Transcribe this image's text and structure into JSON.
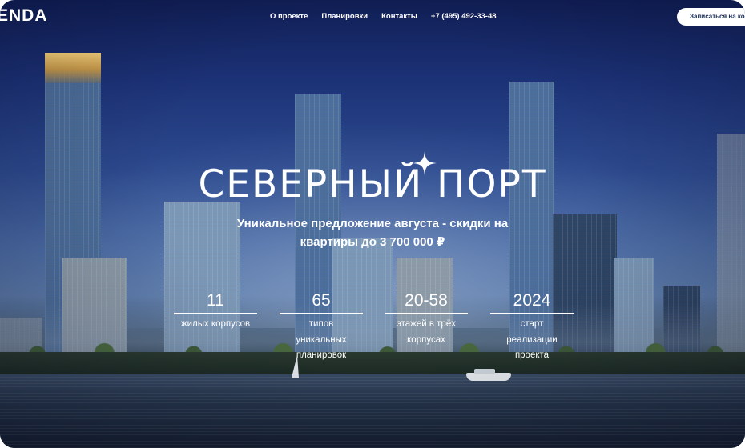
{
  "header": {
    "logo": "ENDA",
    "nav": [
      {
        "label": "О проекте"
      },
      {
        "label": "Планировки"
      },
      {
        "label": "Контакты"
      },
      {
        "label": "+7 (495) 492-33-48"
      }
    ],
    "cta_label": "Записаться на консультацию"
  },
  "hero": {
    "title": "СЕВЕРНЫЙ ПОРТ",
    "subtitle_line1": "Уникальное предложение августа - скидки на",
    "subtitle_line2": "квартиры до 3 700 000 ₽"
  },
  "stats": [
    {
      "value": "11",
      "lines": [
        "жилых корпусов"
      ]
    },
    {
      "value": "65",
      "lines": [
        "типов",
        "уникальных",
        "планировок"
      ]
    },
    {
      "value": "20-58",
      "lines": [
        "этажей в трёх",
        "корпусах"
      ]
    },
    {
      "value": "2024",
      "lines": [
        "старт",
        "реализации",
        "проекта"
      ]
    }
  ],
  "colors": {
    "accent": "#ffffff",
    "cta_text": "#1b2d56",
    "sky_top": "#101e55"
  },
  "icons": {
    "sparkle": "four-point-star"
  }
}
